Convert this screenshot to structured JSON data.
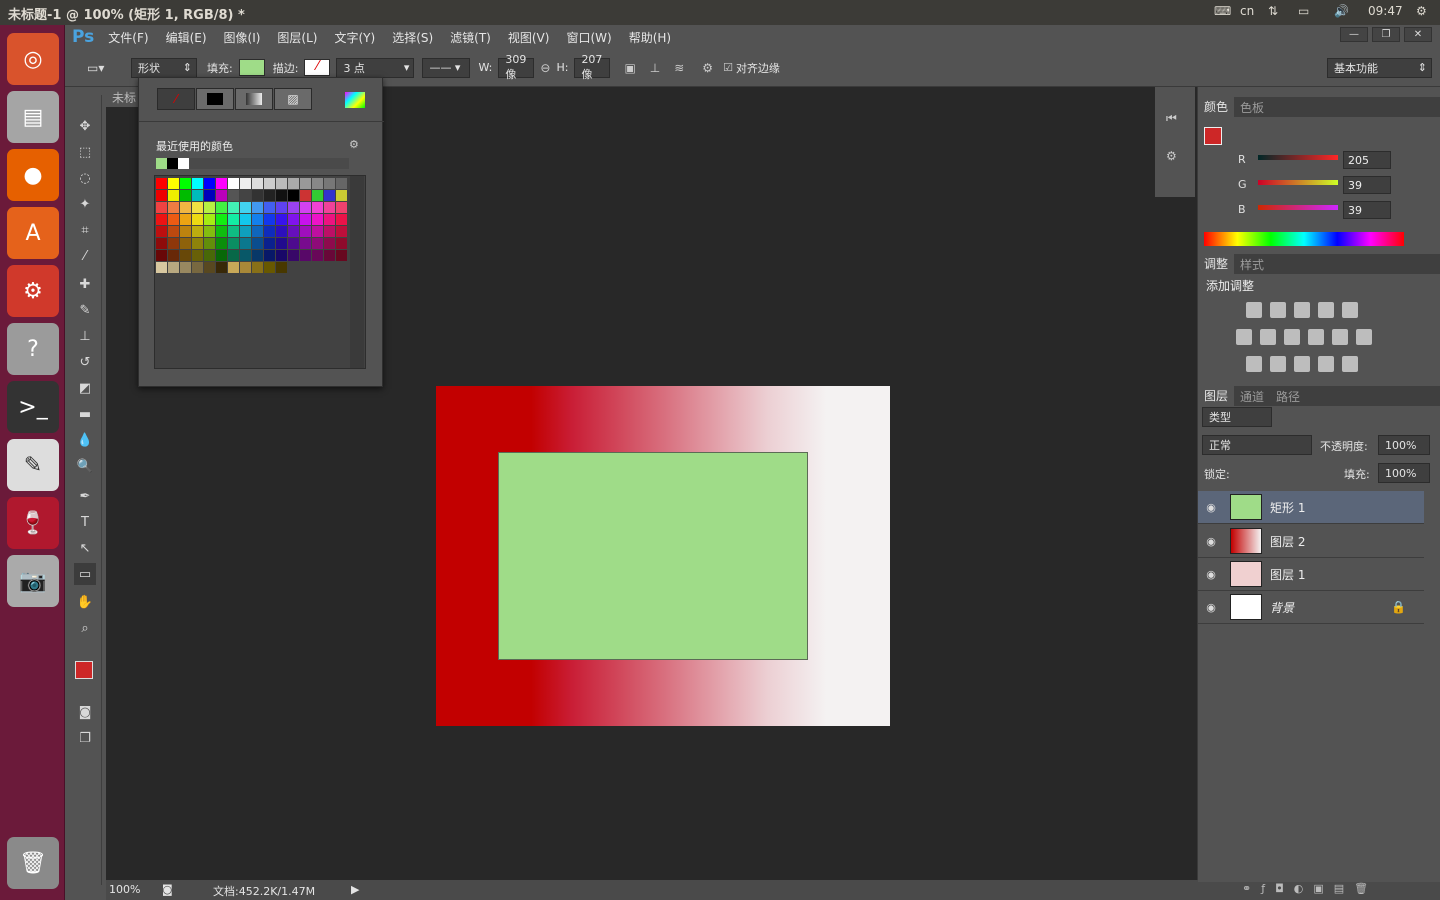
{
  "os": {
    "window_title": "未标题-1 @ 100% (矩形 1, RGB/8) *",
    "lang": "cn",
    "time": "09:47"
  },
  "menu": {
    "logo": "Ps",
    "items": [
      "文件(F)",
      "编辑(E)",
      "图像(I)",
      "图层(L)",
      "文字(Y)",
      "选择(S)",
      "滤镜(T)",
      "视图(V)",
      "窗口(W)",
      "帮助(H)"
    ]
  },
  "options": {
    "mode": "形状",
    "fill_label": "填充:",
    "stroke_label": "描边:",
    "stroke_size": "3 点",
    "w_label": "W:",
    "w_value": "309 像",
    "h_label": "H:",
    "h_value": "207 像",
    "align_edges": "对齐边缘",
    "workspace": "基本功能"
  },
  "doc": {
    "tab": "未标"
  },
  "popup": {
    "recent_label": "最近使用的颜色",
    "colors_fill": "#9fdc88"
  },
  "status": {
    "zoom": "100%",
    "doc_info": "文档:452.2K/1.47M"
  },
  "color_panel": {
    "tabs": [
      "颜色",
      "色板"
    ],
    "r_label": "R",
    "g_label": "G",
    "b_label": "B",
    "r": "205",
    "g": "39",
    "b": "39",
    "fg": "#cd2727"
  },
  "adjust_panel": {
    "tabs": [
      "调整",
      "样式"
    ],
    "title": "添加调整"
  },
  "layers_panel": {
    "tabs": [
      "图层",
      "通道",
      "路径"
    ],
    "kind": "类型",
    "blend": "正常",
    "opacity_label": "不透明度:",
    "opacity": "100%",
    "lock_label": "锁定:",
    "fill_label": "填充:",
    "fill": "100%",
    "layers": [
      {
        "name": "矩形 1"
      },
      {
        "name": "图层 2"
      },
      {
        "name": "图层 1"
      },
      {
        "name": "背景"
      }
    ]
  }
}
